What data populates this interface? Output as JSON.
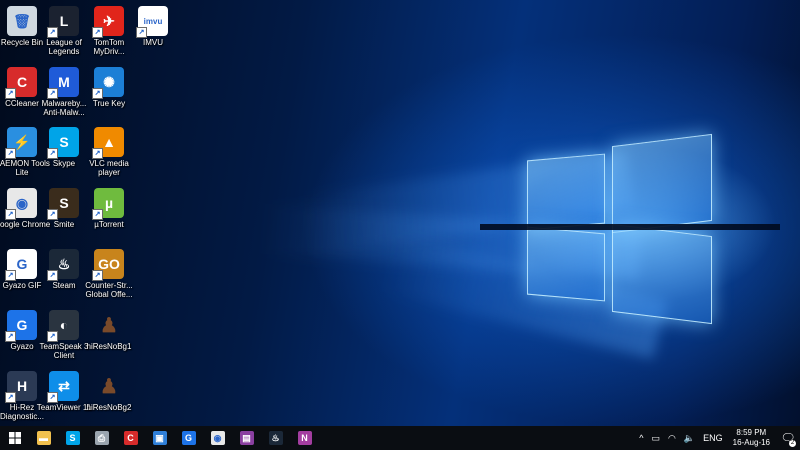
{
  "desktop_icons": [
    {
      "label": "Recycle Bin",
      "icon": "recycle-bin-icon",
      "color": "#cfd8e0",
      "glyph": "🗑",
      "shortcut": false
    },
    {
      "label": "CCleaner",
      "icon": "ccleaner-icon",
      "color": "#d72b2b",
      "glyph": "C",
      "shortcut": true
    },
    {
      "label": "DAEMON Tools Lite",
      "icon": "daemon-tools-icon",
      "color": "#2a8fe0",
      "glyph": "⚡",
      "shortcut": true
    },
    {
      "label": "Google Chrome",
      "icon": "chrome-icon",
      "color": "#e8e8e8",
      "glyph": "◉",
      "shortcut": true
    },
    {
      "label": "Gyazo GIF",
      "icon": "gyazo-gif-icon",
      "color": "#ffffff",
      "glyph": "G",
      "shortcut": true
    },
    {
      "label": "Gyazo",
      "icon": "gyazo-icon",
      "color": "#1d73e8",
      "glyph": "G",
      "shortcut": true
    },
    {
      "label": "Hi-Rez Diagnostic...",
      "icon": "hirez-diagnostic-icon",
      "color": "#2b3a55",
      "glyph": "H",
      "shortcut": true
    },
    {
      "label": "League of Legends",
      "icon": "league-of-legends-icon",
      "color": "#1b2230",
      "glyph": "L",
      "shortcut": true
    },
    {
      "label": "Malwareby... Anti-Malw...",
      "icon": "malwarebytes-icon",
      "color": "#1f5bd8",
      "glyph": "M",
      "shortcut": true
    },
    {
      "label": "Skype",
      "icon": "skype-icon",
      "color": "#00a4e8",
      "glyph": "S",
      "shortcut": true
    },
    {
      "label": "Smite",
      "icon": "smite-icon",
      "color": "#3a2c1c",
      "glyph": "S",
      "shortcut": true
    },
    {
      "label": "Steam",
      "icon": "steam-icon",
      "color": "#1b2838",
      "glyph": "♨",
      "shortcut": true
    },
    {
      "label": "TeamSpeak 3 Client",
      "icon": "teamspeak-icon",
      "color": "#2a3440",
      "glyph": "◐",
      "shortcut": true
    },
    {
      "label": "TeamViewer 11",
      "icon": "teamviewer-icon",
      "color": "#0e8ee9",
      "glyph": "⇄",
      "shortcut": true
    },
    {
      "label": "TomTom MyDriv...",
      "icon": "tomtom-icon",
      "color": "#e1251b",
      "glyph": "✈",
      "shortcut": true
    },
    {
      "label": "True Key",
      "icon": "true-key-icon",
      "color": "#1c7fd6",
      "glyph": "✺",
      "shortcut": true
    },
    {
      "label": "VLC media player",
      "icon": "vlc-icon",
      "color": "#f08a00",
      "glyph": "▲",
      "shortcut": true
    },
    {
      "label": "µTorrent",
      "icon": "utorrent-icon",
      "color": "#6fbb3e",
      "glyph": "µ",
      "shortcut": true
    },
    {
      "label": "Counter-Str... Global Offe...",
      "icon": "csgo-icon",
      "color": "#c8841c",
      "glyph": "GO",
      "shortcut": true
    },
    {
      "label": "hiResNoBg1",
      "icon": "image-file-icon",
      "color": "rgba(0,0,0,0)",
      "glyph": "♟",
      "shortcut": false
    },
    {
      "label": "hiResNoBg2",
      "icon": "image-file-icon",
      "color": "rgba(0,0,0,0)",
      "glyph": "♟",
      "shortcut": false
    },
    {
      "label": "IMVU",
      "icon": "imvu-icon",
      "color": "#ffffff",
      "glyph": "imvu",
      "shortcut": true
    }
  ],
  "taskbar": {
    "start_icon": "windows-start-icon",
    "pinned": [
      {
        "name": "file-explorer",
        "icon": "folder-icon",
        "color": "#f2c14e",
        "glyph": "▬"
      },
      {
        "name": "skype",
        "icon": "skype-icon",
        "color": "#00a4e8",
        "glyph": "S"
      },
      {
        "name": "printer-app",
        "icon": "printer-icon",
        "color": "#9aa4ae",
        "glyph": "⎙"
      },
      {
        "name": "ccleaner",
        "icon": "ccleaner-icon",
        "color": "#d72b2b",
        "glyph": "C"
      },
      {
        "name": "window-app",
        "icon": "window-icon",
        "color": "#2f7fd8",
        "glyph": "▣"
      },
      {
        "name": "gyazo",
        "icon": "gyazo-icon",
        "color": "#1d73e8",
        "glyph": "G"
      },
      {
        "name": "chrome",
        "icon": "chrome-icon",
        "color": "#e8e8e8",
        "glyph": "◉"
      },
      {
        "name": "winrar",
        "icon": "archive-icon",
        "color": "#8a3fa0",
        "glyph": "▤"
      },
      {
        "name": "steam",
        "icon": "steam-icon",
        "color": "#1b2838",
        "glyph": "♨"
      },
      {
        "name": "onenote",
        "icon": "onenote-icon",
        "color": "#a33ea0",
        "glyph": "N"
      }
    ],
    "tray": {
      "chevron": "^",
      "language": "ENG",
      "time": "8:59 PM",
      "date": "16-Aug-16",
      "notification_count": "2"
    }
  }
}
